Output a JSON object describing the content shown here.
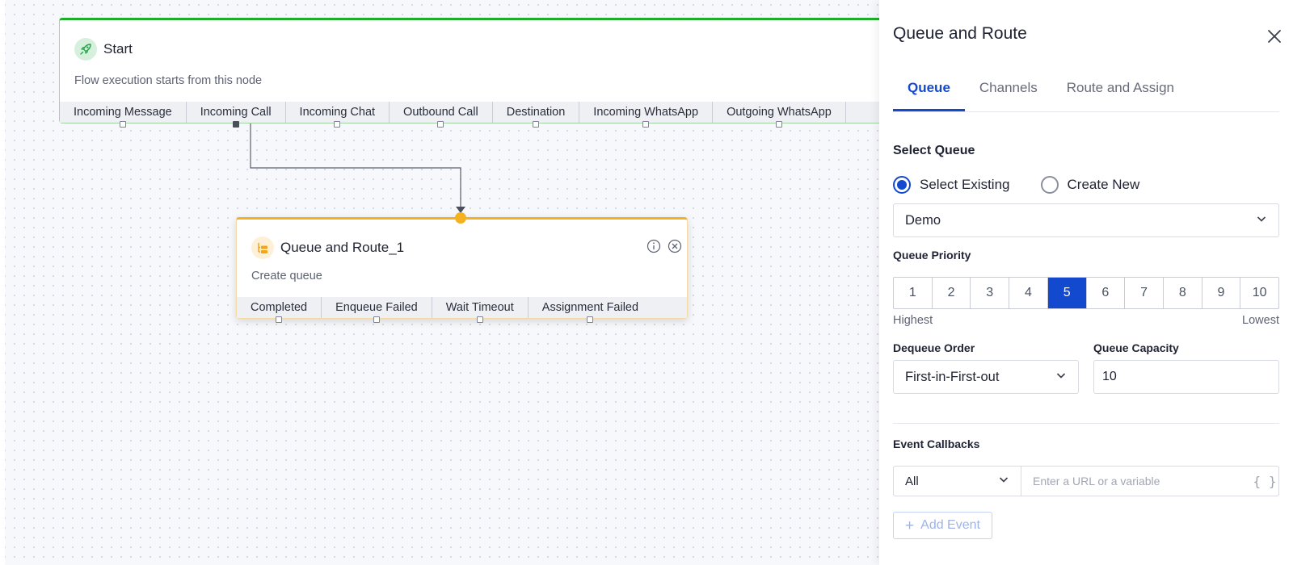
{
  "start_node": {
    "title": "Start",
    "description": "Flow execution starts from this node",
    "outputs": [
      "Incoming Message",
      "Incoming Call",
      "Incoming Chat",
      "Outbound Call",
      "Destination",
      "Incoming WhatsApp",
      "Outgoing WhatsApp"
    ]
  },
  "queue_node": {
    "title": "Queue and Route_1",
    "description": "Create queue",
    "outputs": [
      "Completed",
      "Enqueue Failed",
      "Wait Timeout",
      "Assignment Failed"
    ]
  },
  "panel": {
    "title": "Queue and Route",
    "tabs": [
      {
        "label": "Queue",
        "active": true
      },
      {
        "label": "Channels",
        "active": false
      },
      {
        "label": "Route and Assign",
        "active": false
      }
    ],
    "select_queue": {
      "title": "Select Queue",
      "options": [
        "Select Existing",
        "Create New"
      ],
      "selected_option": "Select Existing",
      "queue_value": "Demo"
    },
    "priority": {
      "label": "Queue Priority",
      "values": [
        "1",
        "2",
        "3",
        "4",
        "5",
        "6",
        "7",
        "8",
        "9",
        "10"
      ],
      "selected": "5",
      "highest_label": "Highest",
      "lowest_label": "Lowest"
    },
    "dequeue": {
      "label": "Dequeue Order",
      "value": "First-in-First-out"
    },
    "capacity": {
      "label": "Queue Capacity",
      "value": "10"
    },
    "callbacks": {
      "label": "Event Callbacks",
      "event_value": "All",
      "url_placeholder": "Enter a URL or a variable",
      "variable_symbol": "{ }"
    },
    "add_event_label": "Add Event"
  },
  "colors": {
    "accent": "#1349cf",
    "start_accent": "#1fae2c",
    "queue_accent": "#f5b120"
  }
}
